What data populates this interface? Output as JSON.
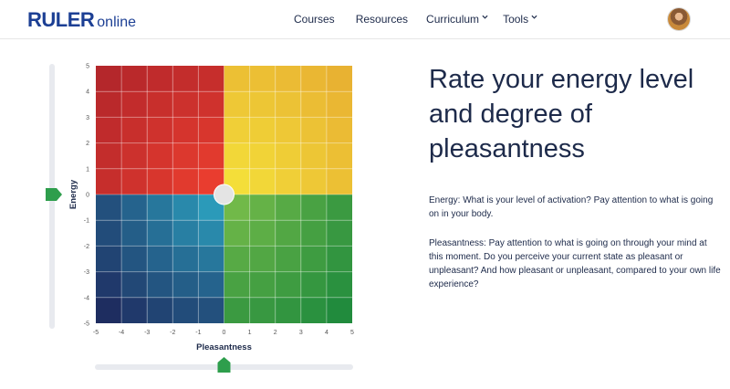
{
  "header": {
    "logo_main": "RULER",
    "logo_sub": "online",
    "nav": [
      {
        "label": "Courses",
        "has_dropdown": false
      },
      {
        "label": "Resources",
        "has_dropdown": false
      },
      {
        "label": "Curriculum",
        "has_dropdown": true
      },
      {
        "label": "Tools",
        "has_dropdown": true
      }
    ],
    "avatar_icon": "user-avatar"
  },
  "chart_data": {
    "type": "heatmap",
    "title": "",
    "xlabel": "Pleasantness",
    "ylabel": "Energy",
    "xlim": [
      -5,
      5
    ],
    "ylim": [
      -5,
      5
    ],
    "x_ticks": [
      "-5",
      "-4",
      "-3",
      "-2",
      "-1",
      "0",
      "1",
      "2",
      "3",
      "4",
      "5"
    ],
    "y_ticks": [
      "5",
      "4",
      "3",
      "2",
      "1",
      "0",
      "-1",
      "-2",
      "-3",
      "-4",
      "-5"
    ],
    "grid": true,
    "quadrant_colors": {
      "high_energy_unpleasant": "#d8302e",
      "high_energy_pleasant": "#f2cc2f",
      "low_energy_unpleasant": "#284a8e",
      "low_energy_pleasant": "#2f9a48"
    },
    "selected_point": {
      "pleasantness": 0,
      "energy": 0
    },
    "energy_slider_value": 0,
    "pleasantness_slider_value": 0,
    "slider_handle_color": "#2e9e4c"
  },
  "main": {
    "heading": "Rate your energy level and degree of pleasantness",
    "energy_text": "Energy: What is your level of activation? Pay attention to what is going on in your body.",
    "pleasantness_text": "Pleasantness: Pay attention to what is going on through your mind at this moment. Do you perceive your current state as pleasant or unpleasant? And how pleasant or unpleasant, compared to your own life experience?"
  }
}
